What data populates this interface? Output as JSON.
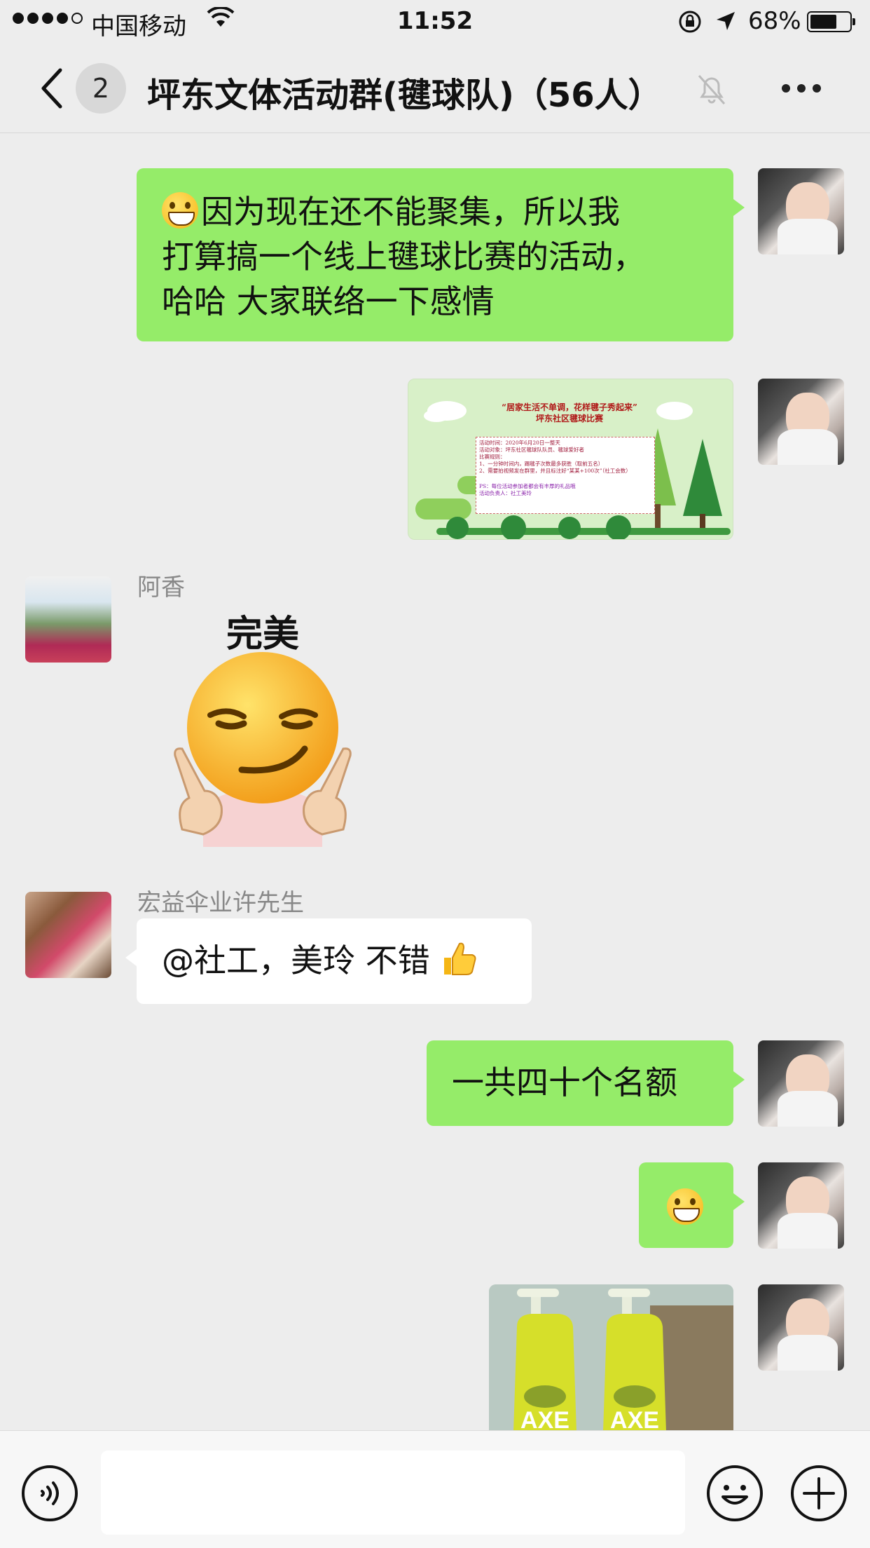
{
  "status_bar": {
    "carrier": "中国移动",
    "time": "11:52",
    "battery_percent": "68%",
    "battery_level": 0.68,
    "icons": [
      "signal-dots",
      "wifi-icon",
      "orientation-lock-icon",
      "location-arrow-icon",
      "battery-icon"
    ]
  },
  "nav": {
    "unread_count": "2",
    "title": "坪东文体活动群(毽球队)（56人）",
    "icons": [
      "back-chevron-icon",
      "mute-bell-icon",
      "more-icon"
    ]
  },
  "messages": {
    "m1": {
      "direction": "out",
      "lines": [
        "因为现在还不能聚集，所以我",
        "打算搞一个线上毽球比赛的活动，",
        "哈哈  大家联络一下感情"
      ]
    },
    "m2": {
      "direction": "out",
      "type": "image",
      "poster_title_1": "“居家生活不单调，花样毽子秀起来”",
      "poster_title_2": "坪东社区毽球比赛",
      "poster_lines": [
        "活动时间：2020年6月20日一整天",
        "活动对象：坪东社区毽球队队员、毽球爱好者",
        "比赛规则：",
        "1、一分钟时间内，踢毽子次数最多获胜（取前五名）",
        "2、需要拍视频发在群里，并且标注好“某某+100次”（社工会数）"
      ],
      "poster_ps": "PS：每位活动参加者都会有丰厚的礼品哦",
      "poster_contact": "活动负责人：社工美玲"
    },
    "m3": {
      "direction": "in",
      "sender": "阿香",
      "type": "sticker",
      "caption": "完美"
    },
    "m4": {
      "direction": "in",
      "sender": "宏益伞业许先生",
      "text": "@社工，美玲 不错"
    },
    "m5": {
      "direction": "out",
      "text": "一共四十个名额"
    },
    "m6": {
      "direction": "out",
      "type": "emoji",
      "emoji": "grin-emoji"
    },
    "m7": {
      "direction": "out",
      "type": "image",
      "label": "AXE",
      "subject": "two yellow-green pump bottles"
    }
  },
  "input_bar": {
    "placeholder": "",
    "icons": [
      "voice-icon",
      "emoji-face-icon",
      "plus-icon"
    ]
  },
  "colors": {
    "outgoing_bubble": "#95ec69",
    "incoming_bubble": "#ffffff",
    "background": "#ededed"
  }
}
